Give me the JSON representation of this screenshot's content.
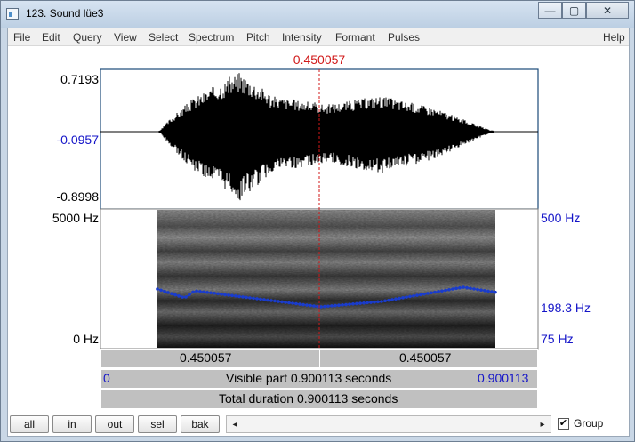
{
  "window": {
    "title": "123. Sound lüe3",
    "minimize_glyph": "—",
    "maximize_glyph": "▢",
    "close_glyph": "✕"
  },
  "background_titles": [
    "...",
    "...",
    "..."
  ],
  "menu": [
    "File",
    "Edit",
    "Query",
    "View",
    "Select",
    "Spectrum",
    "Pitch",
    "Intensity",
    "Formant",
    "Pulses",
    "Help"
  ],
  "cursor": {
    "time_label": "0.450057",
    "color": "#d01818"
  },
  "waveform": {
    "y_max": "0.7193",
    "y_cursor": "-0.0957",
    "y_min": "-0.8998"
  },
  "spectrogram": {
    "freq_max": "5000 Hz",
    "freq_min": "0 Hz",
    "pitch_max": "500 Hz",
    "pitch_at_cursor": "198.3 Hz",
    "pitch_min": "75 Hz",
    "pitch_color": "#1a3ccc"
  },
  "time_bars": {
    "left_segment": "0.450057",
    "right_segment": "0.450057",
    "visible_start": "0",
    "visible_label": "Visible part 0.900113 seconds",
    "visible_end": "0.900113",
    "total_label": "Total duration 0.900113 seconds"
  },
  "buttons": [
    "all",
    "in",
    "out",
    "sel",
    "bak"
  ],
  "group": {
    "label": "Group",
    "checked": true,
    "check_glyph": "✔"
  },
  "icons": {
    "scroll_left": "◂",
    "scroll_right": "▸"
  }
}
